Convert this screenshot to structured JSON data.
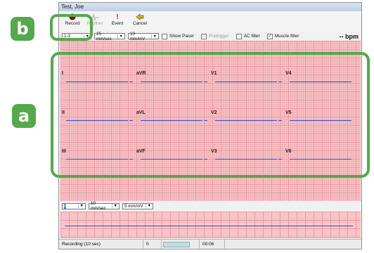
{
  "callouts": {
    "a": "a",
    "b": "b"
  },
  "window": {
    "title": "Test, Joe"
  },
  "toolbar": {
    "record_label": "Record",
    "rhythm_label": "Rhythm",
    "event_label": "Event",
    "cancel_label": "Cancel"
  },
  "controls": {
    "lead_select": "1-3",
    "speed_select": "25 mm/sec",
    "gain_select": "10 mm/mV",
    "show_pacer": "Show Pacer",
    "pretrigger": "Pretrigger",
    "ac_filter": "AC filter",
    "muscle_filter": "Muscle filter",
    "muscle_filter_checked": "✓",
    "pretrigger_checked": "✓",
    "bpm": "-- bpm"
  },
  "leads": [
    "I",
    "aVR",
    "V1",
    "V4",
    "II",
    "aVL",
    "V2",
    "V5",
    "III",
    "aVF",
    "V3",
    "V6"
  ],
  "rhythm_controls": {
    "lead_select": "II",
    "speed_select": "10 mm/sec",
    "gain_select": "5 mm/mV"
  },
  "status": {
    "label": "Recording (10 sec)",
    "counter": "0",
    "time": "00:06"
  }
}
